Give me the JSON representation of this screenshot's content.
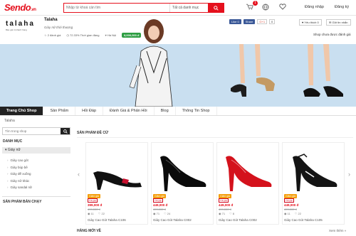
{
  "header": {
    "logo": "Sendo",
    "logo_suffix": ".vn",
    "search_placeholder": "Nhập từ khoá cần tìm",
    "search_category": "Tất cả danh mục",
    "cart_count": "1",
    "login": "Đăng nhập",
    "register": "Đăng ký"
  },
  "shop": {
    "logo_text": "talaha",
    "logo_sub": "Bảo giá trị khách hàng",
    "name": "Talaha",
    "slogan": "Giày nữ thời thượng",
    "stat_rating": "2 đánh giá",
    "stat_ontime": "72.33% Thời gian đáng",
    "stat_place": "Hà Nội",
    "stat_money": "8,000,000 đ",
    "fb_like": "Like 0",
    "fb_share": "Share",
    "gplus": "G+1",
    "gplus_count": "0",
    "favorite": "Yêu thích",
    "fav_count": "0",
    "chat": "Gửi tin nhắn",
    "rating_link": "Shop chưa được đánh giá"
  },
  "nav": {
    "tabs": [
      "Trang Chủ Shop",
      "Sản Phẩm",
      "Hỏi Đáp",
      "Đánh Giá & Phản Hồi",
      "Blog",
      "Thông Tin Shop"
    ],
    "active": 0
  },
  "breadcrumb": "Talaha",
  "sidebar": {
    "search_placeholder": "Tìm trong shop",
    "section_title": "DANH MỤC",
    "category": "Giày nữ",
    "items": [
      "Giày cao gót",
      "Giày búp bê",
      "Giày đế xuồng",
      "Giày nữ khác",
      "Giày sandal nữ"
    ],
    "featured_title": "SẢN PHẨM BÁN CHẠY"
  },
  "products": {
    "section_title": "SẢN PHẨM ĐỀ CỬ",
    "new_title": "HÀNG MỚI VỀ",
    "view_all": "Xem thêm »",
    "sale_badge": "Giảm giá",
    "installment_badge": "Trả góp",
    "items": [
      {
        "name": "Giày Cao Gót Talaha C106",
        "price": "399,000 đ",
        "old_price": "499,000 đ",
        "views": "11",
        "likes": "22",
        "color": "#111111",
        "accent": "#c8102e"
      },
      {
        "name": "Giày Cao Gót Talaha C002",
        "price": "449,000 đ",
        "old_price": "499,000 đ",
        "views": "71",
        "likes": "24",
        "color": "#0b0b0b",
        "accent": "#0b0b0b"
      },
      {
        "name": "Giày Cao Gót Talaha C002",
        "price": "449,000 đ",
        "old_price": "499,000 đ",
        "views": "71",
        "likes": "8",
        "color": "#d4121c",
        "accent": "#d4121c"
      },
      {
        "name": "Giày Cao Gót Talaha C105",
        "price": "449,000 đ",
        "old_price": "499,000 đ",
        "views": "11",
        "likes": "22",
        "color": "#141414",
        "accent": "#ffffff"
      }
    ]
  },
  "colors": {
    "brand": "#e5101d",
    "banner_bg": "#c9dff0",
    "money_badge": "#2e9e43"
  }
}
